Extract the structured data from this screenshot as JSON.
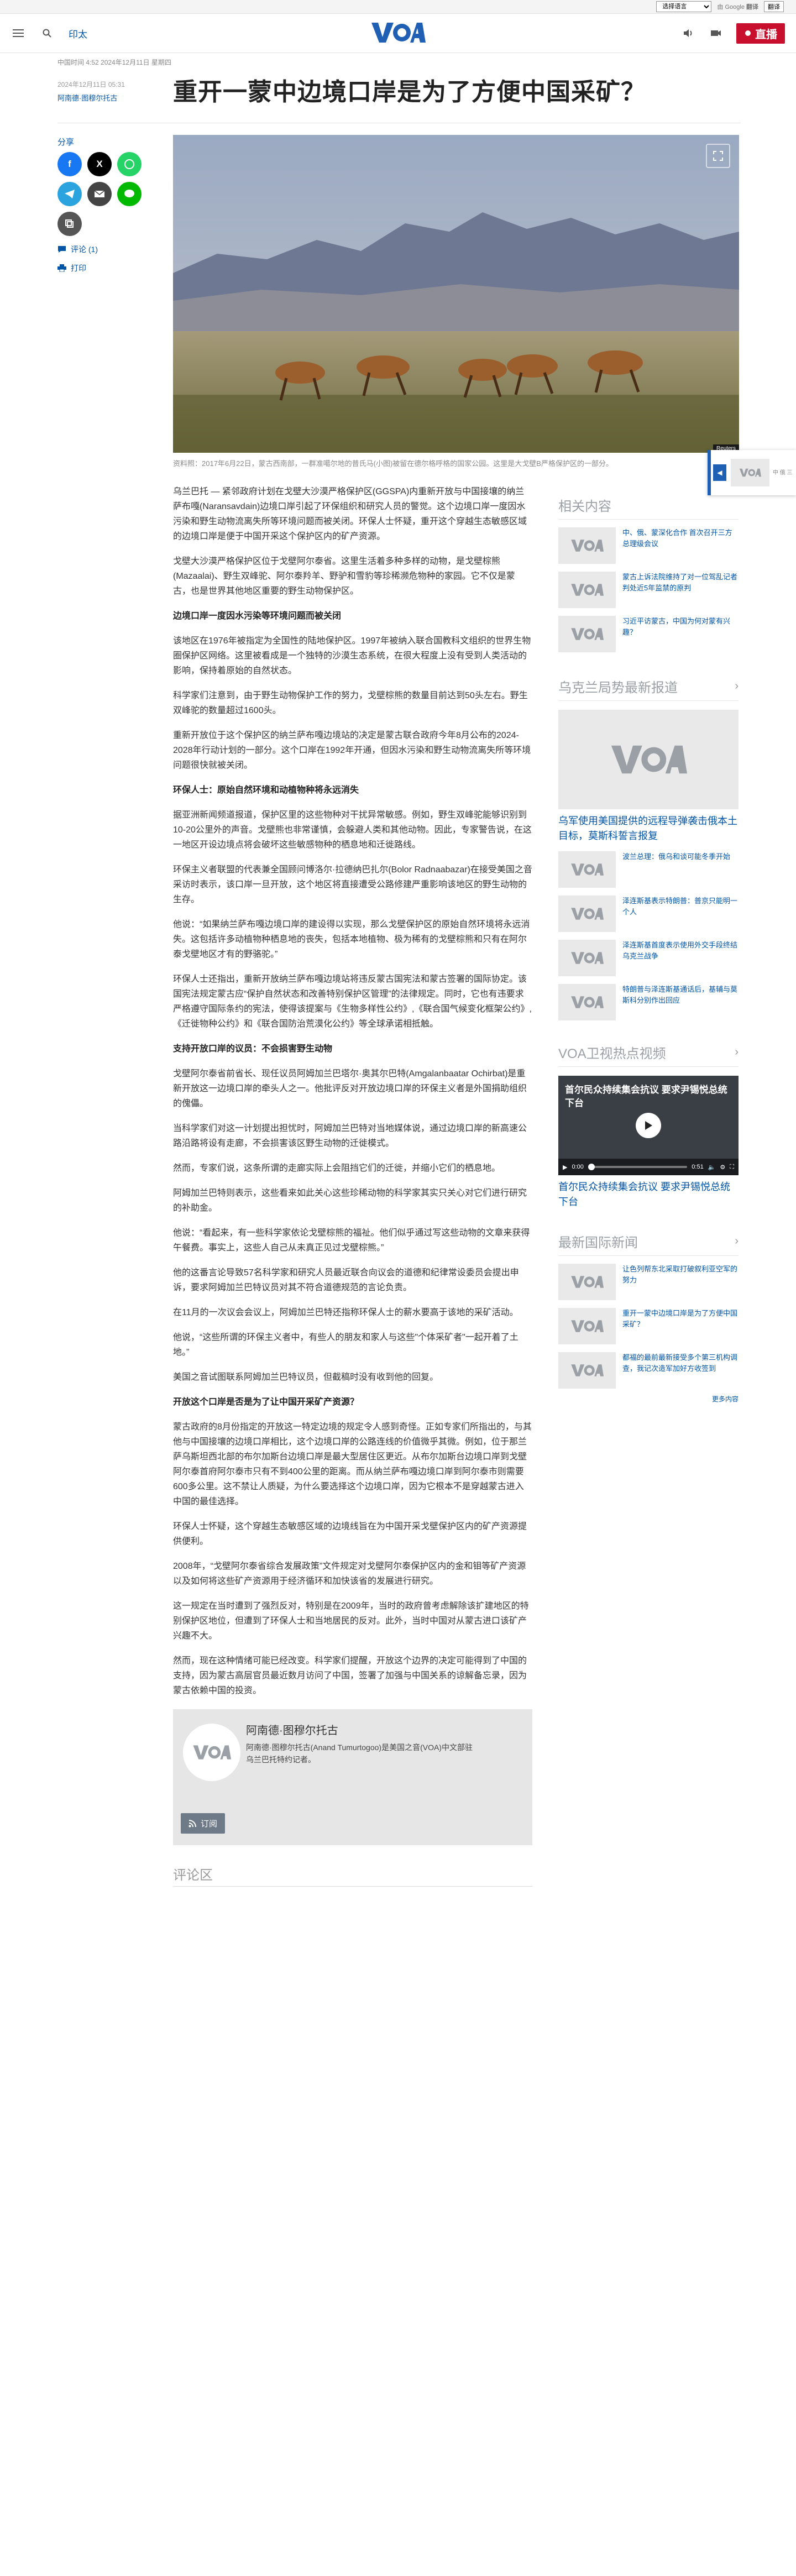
{
  "lang_bar": {
    "select_value": "选择语言",
    "google_label": "由 Google",
    "translate_label": "翻译",
    "translate_button": "翻译"
  },
  "nav": {
    "section": "印太",
    "live_label": "直播"
  },
  "article": {
    "first_published": "中国时间 4:52 2024年12月11日 星期四",
    "date": "2024年12月11日 05:31",
    "author": "阿南德·图穆尔托古",
    "headline": "重开一蒙中边境口岸是为了方便中国采矿？",
    "share_label": "分享",
    "comment_link": "评论 (1)",
    "print_link": "打印",
    "image_credit": "Reuters",
    "caption": "资料照：2017年6月22日，蒙古西南部，一群准噶尔地的普氏马(小图)被留在德尔格呼格的国家公园。这里是大戈壁B严格保护区的一部分。",
    "paragraphs": [
      {
        "kind": "p",
        "text": "乌兰巴托 — 紧邻政府计划在戈壁大沙漠严格保护区(GGSPA)内重新开放与中国接壤的纳兰萨布嘎(Naransavdain)边境口岸引起了环保组织和研究人员的警觉。这个边境口岸一度因水污染和野生动物流离失所等环境问题而被关闭。环保人士怀疑，重开这个穿越生态敏感区域的边境口岸是便于中国开采这个保护区内的矿产资源。"
      },
      {
        "kind": "p",
        "text": "戈壁大沙漠严格保护区位于戈壁阿尔泰省。这里生活着多种多样的动物，是戈壁棕熊(Mazaalai)、野生双峰驼、阿尔泰羚羊、野驴和雪豹等珍稀濒危物种的家园。它不仅是蒙古，也是世界其他地区重要的野生动物保护区。"
      },
      {
        "kind": "h",
        "text": "边境口岸一度因水污染等环境问题而被关闭"
      },
      {
        "kind": "p",
        "text": "该地区在1976年被指定为全国性的陆地保护区。1997年被纳入联合国教科文组织的世界生物圈保护区网络。这里被看成是一个独特的沙漠生态系统，在很大程度上没有受到人类活动的影响，保持着原始的自然状态。"
      },
      {
        "kind": "p",
        "text": "科学家们注意到，由于野生动物保护工作的努力，戈壁棕熊的数量目前达到50头左右。野生双峰驼的数量超过1600头。"
      },
      {
        "kind": "p",
        "text": "重新开放位于这个保护区的纳兰萨布嘎边境站的决定是蒙古联合政府今年8月公布的2024-2028年行动计划的一部分。这个口岸在1992年开通，但因水污染和野生动物流离失所等环境问题很快就被关闭。"
      },
      {
        "kind": "h",
        "text": "环保人士：原始自然环境和动植物种将永远消失"
      },
      {
        "kind": "p",
        "text": "据亚洲新闻频道报道，保护区里的这些物种对干扰异常敏感。例如，野生双峰驼能够识别到10-20公里外的声音。戈壁熊也非常谨慎，会躲避人类和其他动物。因此，专家警告说，在这一地区开设边境点将会破坏这些敏感物种的栖息地和迁徙路线。"
      },
      {
        "kind": "p",
        "text": "环保主义者联盟的代表兼全国顾问博洛尔·拉德纳巴扎尔(Bolor Radnaabazar)在接受美国之音采访时表示，该口岸一旦开放，这个地区将直接遭受公路修建严重影响该地区的野生动物的生存。"
      },
      {
        "kind": "p",
        "text": "他说：“如果纳兰萨布嘎边境口岸的建设得以实现，那么戈壁保护区的原始自然环境将永远消失。这包括许多动植物种栖息地的丧失，包括本地植物、极为稀有的戈壁棕熊和只有在阿尔泰戈壁地区才有的野骆驼。”"
      },
      {
        "kind": "p",
        "text": "环保人士还指出，重新开放纳兰萨布嘎边境站将违反蒙古国宪法和蒙古签署的国际协定。该国宪法规定蒙古应“保护自然状态和改善特别保护区管理”的法律规定。同时，它也有违要求严格遵守国际条约的宪法，使得该提案与《生物多样性公约》,《联合国气候变化框架公约》,《迁徙物种公约》和《联合国防治荒漠化公约》等全球承诺相抵触。"
      },
      {
        "kind": "h",
        "text": "支持开放口岸的议员：不会损害野生动物"
      },
      {
        "kind": "p",
        "text": "戈壁阿尔泰省前省长、现任议员阿姆加兰巴塔尔·奥其尔巴特(Amgalanbaatar Ochirbat)是重新开放这一边境口岸的牵头人之一。他批评反对开放边境口岸的环保主义者是外国捐助组织的傀儡。"
      },
      {
        "kind": "p",
        "text": "当科学家们对这一计划提出担忧时，阿姆加兰巴特对当地媒体说，通过边境口岸的新高速公路沿路将设有走廊，不会损害该区野生动物的迁徙模式。"
      },
      {
        "kind": "p",
        "text": "然而，专家们说，这条所谓的走廊实际上会阻挡它们的迁徙，并缩小它们的栖息地。"
      },
      {
        "kind": "p",
        "text": "阿姆加兰巴特则表示，这些看来如此关心这些珍稀动物的科学家其实只关心对它们进行研究的补助金。"
      },
      {
        "kind": "p",
        "text": "他说：“看起来，有一些科学家依论戈壁棕熊的福祉。他们似乎通过写这些动物的文章来获得午餐费。事实上，这些人自己从未真正见过戈壁棕熊。”"
      },
      {
        "kind": "p",
        "text": "他的这番言论导致57名科学家和研究人员最近联合向议会的道德和纪律常设委员会提出申诉，要求阿姆加兰巴特议员对其不符合道德规范的言论负责。"
      },
      {
        "kind": "p",
        "text": "在11月的一次议会会议上，阿姆加兰巴特还指称环保人士的薪水要高于该地的采矿活动。"
      },
      {
        "kind": "p",
        "text": "他说，“这些所谓的环保主义者中，有些人的朋友和家人与这些\"个体采矿者\"一起开着了土地。”"
      },
      {
        "kind": "p",
        "text": "美国之音试图联系阿姆加兰巴特议员，但截稿时没有收到他的回复。"
      },
      {
        "kind": "h",
        "text": "开放这个口岸是否是为了让中国开采矿产资源？"
      },
      {
        "kind": "p",
        "text": "蒙古政府的8月份指定的开放这一特定边境的规定令人感到奇怪。正如专家们所指出的，与其他与中国接壤的边境口岸相比，这个边境口岸的公路连线的价值微乎其微。例如，位于那兰萨乌斯坦西北部的布尔加斯台边境口岸是最大型居住区更近。从布尔加斯台边境口岸到戈壁阿尔泰首府阿尔泰市只有不到400公里的距离。而从纳兰萨布嘎边境口岸到阿尔泰市则需要600多公里。这不禁让人质疑，为什么要选择这个边境口岸，因为它根本不是穿越蒙古进入中国的最佳选择。"
      },
      {
        "kind": "p",
        "text": "环保人士怀疑，这个穿越生态敏感区域的边境线旨在为中国开采戈壁保护区内的矿产资源提供便利。"
      },
      {
        "kind": "p",
        "text": "2008年，“戈壁阿尔泰省综合发展政策”文件规定对戈壁阿尔泰保护区内的金和钼等矿产资源以及如何将这些矿产资源用于经济循环和加快该省的发展进行研究。"
      },
      {
        "kind": "p",
        "text": "这一规定在当时遭到了强烈反对，特别是在2009年，当时的政府曾考虑解除该扩建地区的特别保护区地位，但遭到了环保人士和当地居民的反对。此外，当时中国对从蒙古进口该矿产兴趣不大。"
      },
      {
        "kind": "p",
        "text": "然而，现在这种情绪可能已经改变。科学家们提醒，开放这个边界的决定可能得到了中国的支持，因为蒙古高层官员最近数月访问了中国，签署了加强与中国关系的谅解备忘录，因为蒙古依赖中国的投资。"
      },
      {
        "kind": "p",
        "text": "美国之音就此事向一些政府官员提出问询，但在截稿时没有得到任何人的回应。"
      }
    ],
    "author_box": {
      "name": "阿南德·图穆尔托古",
      "bio": "阿南德·图穆尔托古(Anand Tumurtogoo)是美国之音(VOA)中文部驻乌兰巴托特约记者。",
      "rss_label": "订阅"
    },
    "comments_title": "评论区"
  },
  "rail": {
    "related_title": "相关内容",
    "related": [
      "中、俄、蒙深化合作 首次召开三方总理级会议",
      "蒙古上诉法院维持了对一位驾乱记者判处近5年监禁的原判",
      "习近平访蒙古，中国为何对蒙有兴趣？"
    ],
    "ulaanbaatar_title": "乌克兰局势最新报道",
    "ulaanbaatar_feature": "乌军使用美国提供的远程导弹袭击俄本土目标，莫斯科誓言报复",
    "ulaanbaatar_items": [
      "波兰总理：俄乌和谈可能冬季开始",
      "泽连斯基表示特朗普：普京只能明一个人",
      "泽连斯基首度表示使用外交手段终结乌克兰战争",
      "特朗普与泽连斯基通话后，基辅与莫斯科分别作出回应"
    ],
    "video_title": "VOA卫视热点视频",
    "video_overlay": "首尔民众持续集会抗议 要求尹锡悦总统下台",
    "video_time_current": "0:00",
    "video_time_total": "0:51",
    "video_caption": "首尔民众持续集会抗议 要求尹锡悦总统下台",
    "intl_title": "最新国际新闻",
    "intl_items": [
      "让色列帮东北采取打破叙利亚空军的努力",
      "重开一蒙中边境口岸是为了方便中国采矿？",
      "都福的最前最新接受多个第三机构调查，我记次造军加好方收签到"
    ],
    "more_label": "更多内容"
  },
  "float_card": {
    "text": "中 俄 三"
  },
  "colors": {
    "brand_blue": "#1f5fb4",
    "link_blue": "#0054a6",
    "live_red": "#c8102e",
    "facebook": "#1877f2",
    "x": "#000000",
    "whatsapp": "#25d366",
    "telegram": "#2aa3df",
    "email": "#444444",
    "line": "#00b900",
    "copy": "#555555"
  }
}
